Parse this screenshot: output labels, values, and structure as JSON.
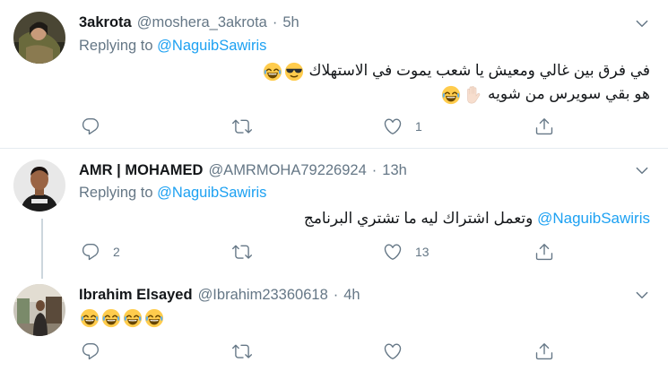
{
  "tweets": [
    {
      "name": "3akrota",
      "handle": "@moshera_3akrota",
      "separator": "·",
      "time": "5h",
      "replying_label": "Replying to",
      "replying_to": "@NaguibSawiris",
      "lines": [
        "في فرق بين غالي ومعيش يا شعب يموت في الاستهلاك",
        "هو بقي سويرس من شويه"
      ],
      "reply_count": "",
      "retweet_count": "",
      "like_count": "1"
    },
    {
      "name": "AMR | MOHAMED",
      "handle": "@AMRMOHA79226924",
      "separator": "·",
      "time": "13h",
      "replying_label": "Replying to",
      "replying_to": "@NaguibSawiris",
      "mention": "@NaguibSawiris",
      "text": "وتعمل اشتراك ليه ما تشتري البرنامج",
      "reply_count": "2",
      "retweet_count": "",
      "like_count": "13"
    },
    {
      "name": "Ibrahim Elsayed",
      "handle": "@Ibrahim23360618",
      "separator": "·",
      "time": "4h",
      "reply_count": "",
      "retweet_count": "",
      "like_count": ""
    }
  ],
  "icons": [
    "reply-icon",
    "retweet-icon",
    "like-icon",
    "share-icon",
    "chevron-down-icon",
    "laughing-emoji",
    "sunglasses-emoji",
    "raised-hand-emoji"
  ],
  "colors": {
    "accent": "#1da1f2",
    "muted": "#657786",
    "divider": "#e6ecf0"
  }
}
